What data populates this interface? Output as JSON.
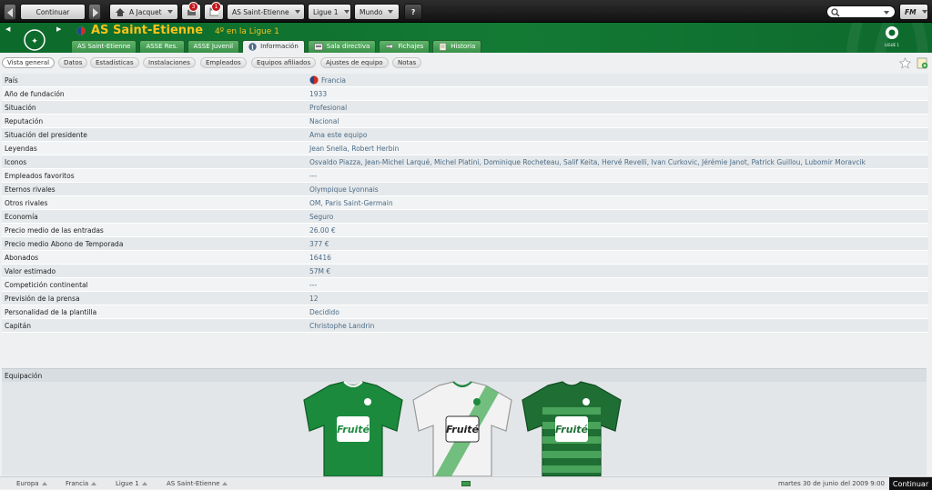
{
  "topbar": {
    "continue_label": "Continuar",
    "manager_label": "A Jacquet",
    "inbox_badge": "3",
    "alerts_badge": "1",
    "club_label": "AS Saint-Etienne",
    "league_label": "Ligue 1",
    "world_label": "Mundo",
    "help_label": "?",
    "fm_label": "FM"
  },
  "header": {
    "club_name": "AS Saint-Etienne",
    "position_text": "4º en la Ligue 1",
    "league_logo_text": "LIGUE 1"
  },
  "tabs": [
    {
      "label": "AS Saint-Etienne"
    },
    {
      "label": "ASSE Res."
    },
    {
      "label": "ASSE Juvenil"
    },
    {
      "label": "Información"
    },
    {
      "label": "Sala directiva"
    },
    {
      "label": "Fichajes"
    },
    {
      "label": "Historia"
    }
  ],
  "subtabs": [
    {
      "label": "Vista general"
    },
    {
      "label": "Datos"
    },
    {
      "label": "Estadísticas"
    },
    {
      "label": "Instalaciones"
    },
    {
      "label": "Empleados"
    },
    {
      "label": "Equipos afiliados"
    },
    {
      "label": "Ajustes de equipo"
    },
    {
      "label": "Notas"
    }
  ],
  "info": [
    {
      "key": "País",
      "value": "Francia"
    },
    {
      "key": "Año de fundación",
      "value": "1933"
    },
    {
      "key": "Situación",
      "value": "Profesional"
    },
    {
      "key": "Reputación",
      "value": "Nacional"
    },
    {
      "key": "Situación del presidente",
      "value": "Ama este equipo"
    },
    {
      "key": "Leyendas",
      "value": "Jean Snella, Robert Herbin"
    },
    {
      "key": "Iconos",
      "value": "Osvaldo Piazza, Jean-Michel Larqué, Michel Platini, Dominique Rocheteau, Salif Keita, Hervé Revelli, Ivan Curkovic, Jérémie Janot, Patrick Guillou, Lubomir Moravcik"
    },
    {
      "key": "Empleados favoritos",
      "value": "---"
    },
    {
      "key": "Eternos rivales",
      "value": "Olympique Lyonnais"
    },
    {
      "key": "Otros rivales",
      "value": "OM, Paris Saint-Germain"
    },
    {
      "key": "Economía",
      "value": "Seguro"
    },
    {
      "key": "Precio medio de las entradas",
      "value": "26.00 €"
    },
    {
      "key": "Precio medio Abono de Temporada",
      "value": "377 €"
    },
    {
      "key": "Abonados",
      "value": "16416"
    },
    {
      "key": "Valor estimado",
      "value": "57M €"
    },
    {
      "key": "Competición continental",
      "value": "---"
    },
    {
      "key": "Previsión de la prensa",
      "value": "12"
    },
    {
      "key": "Personalidad de la plantilla",
      "value": "Decidido"
    },
    {
      "key": "Capitán",
      "value": "Christophe Landrin"
    }
  ],
  "equipment": {
    "title": "Equipación",
    "sponsor_text": "Fruité",
    "kits": [
      {
        "color": "#1b8a3c",
        "secondary": "#f5f5f5"
      },
      {
        "color": "#f2f2f2",
        "secondary": "#5ab56a"
      },
      {
        "color": "#1f6f34",
        "secondary": "#49a35a"
      }
    ]
  },
  "statusbar": {
    "crumbs": [
      "Europa",
      "Francia",
      "Ligue 1",
      "AS Saint-Etienne"
    ],
    "date": "martes 30 de junio del 2009 9:00",
    "continue_label": "Continuar"
  },
  "colors": {
    "accent_green": "#137a34",
    "link_blue": "#4b6b86",
    "badge_red": "#c4161c"
  }
}
